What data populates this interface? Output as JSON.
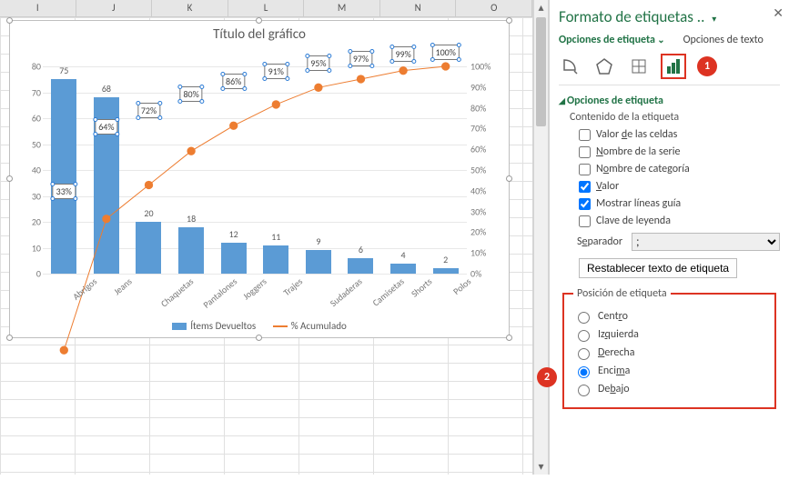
{
  "columns": [
    "I",
    "J",
    "K",
    "L",
    "M",
    "N",
    "O"
  ],
  "chart_data": {
    "type": "bar",
    "title": "Título del gráfico",
    "categories": [
      "Abrigos",
      "Jeans",
      "Chaquetas",
      "Pantalones",
      "Joggers",
      "Trajes",
      "Sudaderas",
      "Camisetas",
      "Shorts",
      "Polos"
    ],
    "series": [
      {
        "name": "Ítems Devueltos",
        "type": "bar",
        "values": [
          75,
          68,
          20,
          18,
          12,
          11,
          9,
          6,
          4,
          2
        ]
      },
      {
        "name": "% Acumulado",
        "type": "line",
        "axis": "secondary",
        "values": [
          33,
          64,
          72,
          80,
          86,
          91,
          95,
          97,
          99,
          100
        ]
      }
    ],
    "ylim": [
      0,
      80
    ],
    "y2lim": [
      0,
      100
    ],
    "y_ticks": [
      0,
      10,
      20,
      30,
      40,
      50,
      60,
      70,
      80
    ],
    "y2_ticks": [
      0,
      10,
      20,
      30,
      40,
      50,
      60,
      70,
      80,
      90,
      100
    ],
    "data_labels_line": [
      "33%",
      "64%",
      "72%",
      "80%",
      "86%",
      "91%",
      "95%",
      "97%",
      "99%",
      "100%"
    ],
    "data_labels_bar": [
      75,
      68,
      20,
      18,
      12,
      11,
      9,
      6,
      4,
      2
    ]
  },
  "legend": {
    "bar": "Ítems Devueltos",
    "line": "% Acumulado"
  },
  "pane": {
    "title": "Formato de etiquetas ..",
    "tab_active": "Opciones de etiqueta",
    "tab_other": "Opciones de texto",
    "section": "Opciones de etiqueta",
    "content_head": "Contenido de la etiqueta",
    "chk_cells": "Valor de las celdas",
    "chk_series": "Nombre de la serie",
    "chk_category": "Nombre de categoría",
    "chk_value": "Valor",
    "chk_leader": "Mostrar líneas guía",
    "chk_legend": "Clave de leyenda",
    "separator_label": "Separador",
    "separator_value": ";",
    "reset": "Restablecer texto de etiqueta",
    "position_head": "Posición de etiqueta",
    "pos_center": "Centro",
    "pos_left": "Izquierda",
    "pos_right": "Derecha",
    "pos_above": "Encima",
    "pos_below": "Debajo"
  },
  "callouts": {
    "one": "1",
    "two": "2"
  }
}
